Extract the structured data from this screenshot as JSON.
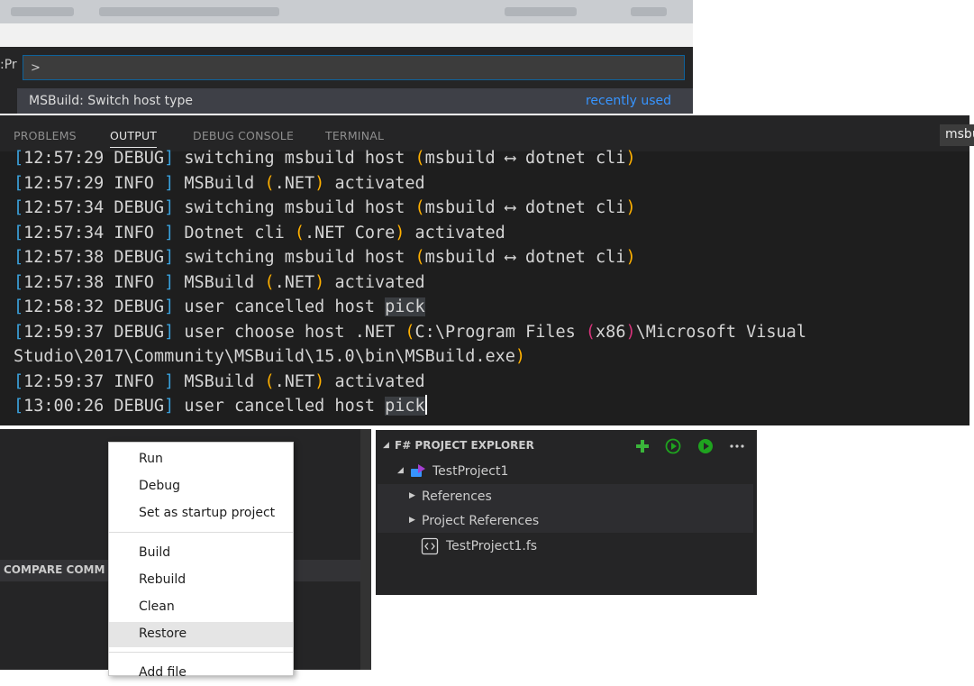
{
  "palette": {
    "left_tab_fragment": ":Pr",
    "input_value": ">",
    "result_label": "MSBuild: Switch host type",
    "result_tag": "recently used"
  },
  "panel": {
    "tabs": [
      "PROBLEMS",
      "OUTPUT",
      "DEBUG CONSOLE",
      "TERMINAL"
    ],
    "active_tab": "OUTPUT",
    "channel_select": "msbuild"
  },
  "log": {
    "lines": [
      [
        {
          "t": "[",
          "c": "br"
        },
        {
          "t": "12:57:29 DEBUG"
        },
        {
          "t": "]",
          "c": "br"
        },
        {
          "t": " switching msbuild host "
        },
        {
          "t": "(",
          "c": "par"
        },
        {
          "t": "msbuild ⟷ dotnet cli"
        },
        {
          "t": ")",
          "c": "par"
        }
      ],
      [
        {
          "t": "[",
          "c": "br"
        },
        {
          "t": "12:57:29 INFO "
        },
        {
          "t": "]",
          "c": "br"
        },
        {
          "t": " MSBuild "
        },
        {
          "t": "(",
          "c": "par"
        },
        {
          "t": ".NET"
        },
        {
          "t": ")",
          "c": "par"
        },
        {
          "t": " activated"
        }
      ],
      [
        {
          "t": "[",
          "c": "br"
        },
        {
          "t": "12:57:34 DEBUG"
        },
        {
          "t": "]",
          "c": "br"
        },
        {
          "t": " switching msbuild host "
        },
        {
          "t": "(",
          "c": "par"
        },
        {
          "t": "msbuild ⟷ dotnet cli"
        },
        {
          "t": ")",
          "c": "par"
        }
      ],
      [
        {
          "t": "[",
          "c": "br"
        },
        {
          "t": "12:57:34 INFO "
        },
        {
          "t": "]",
          "c": "br"
        },
        {
          "t": " Dotnet cli "
        },
        {
          "t": "(",
          "c": "par"
        },
        {
          "t": ".NET Core"
        },
        {
          "t": ")",
          "c": "par"
        },
        {
          "t": " activated"
        }
      ],
      [
        {
          "t": "[",
          "c": "br"
        },
        {
          "t": "12:57:38 DEBUG"
        },
        {
          "t": "]",
          "c": "br"
        },
        {
          "t": " switching msbuild host "
        },
        {
          "t": "(",
          "c": "par"
        },
        {
          "t": "msbuild ⟷ dotnet cli"
        },
        {
          "t": ")",
          "c": "par"
        }
      ],
      [
        {
          "t": "[",
          "c": "br"
        },
        {
          "t": "12:57:38 INFO "
        },
        {
          "t": "]",
          "c": "br"
        },
        {
          "t": " MSBuild "
        },
        {
          "t": "(",
          "c": "par"
        },
        {
          "t": ".NET"
        },
        {
          "t": ")",
          "c": "par"
        },
        {
          "t": " activated"
        }
      ],
      [
        {
          "t": "[",
          "c": "br"
        },
        {
          "t": "12:58:32 DEBUG"
        },
        {
          "t": "]",
          "c": "br"
        },
        {
          "t": " user cancelled host "
        },
        {
          "t": "pick",
          "c": "hl"
        }
      ],
      [
        {
          "t": "[",
          "c": "br"
        },
        {
          "t": "12:59:37 DEBUG"
        },
        {
          "t": "]",
          "c": "br"
        },
        {
          "t": " user choose host .NET "
        },
        {
          "t": "(",
          "c": "par"
        },
        {
          "t": "C:\\Program Files "
        },
        {
          "t": "(",
          "c": "mag"
        },
        {
          "t": "x86"
        },
        {
          "t": ")",
          "c": "mag"
        },
        {
          "t": "\\Microsoft Visual"
        }
      ],
      [
        {
          "t": "Studio\\2017\\Community\\MSBuild\\15.0\\bin\\MSBuild.exe"
        },
        {
          "t": ")",
          "c": "par"
        }
      ],
      [
        {
          "t": "[",
          "c": "br"
        },
        {
          "t": "12:59:37 INFO "
        },
        {
          "t": "]",
          "c": "br"
        },
        {
          "t": " MSBuild "
        },
        {
          "t": "(",
          "c": "par"
        },
        {
          "t": ".NET"
        },
        {
          "t": ")",
          "c": "par"
        },
        {
          "t": " activated"
        }
      ],
      [
        {
          "t": "[",
          "c": "br"
        },
        {
          "t": "13:00:26 DEBUG"
        },
        {
          "t": "]",
          "c": "br"
        },
        {
          "t": " user cancelled host "
        },
        {
          "t": "pick",
          "c": "hl"
        },
        {
          "t": "",
          "c": "cursor"
        }
      ]
    ]
  },
  "compare": {
    "label": "COMPARE COMM"
  },
  "context_menu": {
    "groups": [
      [
        "Run",
        "Debug",
        "Set as startup project"
      ],
      [
        "Build",
        "Rebuild",
        "Clean",
        "Restore"
      ],
      [
        "Add file"
      ]
    ],
    "selected": "Restore"
  },
  "explorer": {
    "title": "F# PROJECT EXPLORER",
    "header_icons": [
      "add-icon",
      "run-outline-icon",
      "run-icon",
      "more-icon"
    ],
    "project": "TestProject1",
    "items": [
      "References",
      "Project References",
      "TestProject1.fs"
    ],
    "colors": {
      "add": "#3ab53a",
      "run": "#1fa31f",
      "project_icon": "#a53fd1"
    }
  }
}
